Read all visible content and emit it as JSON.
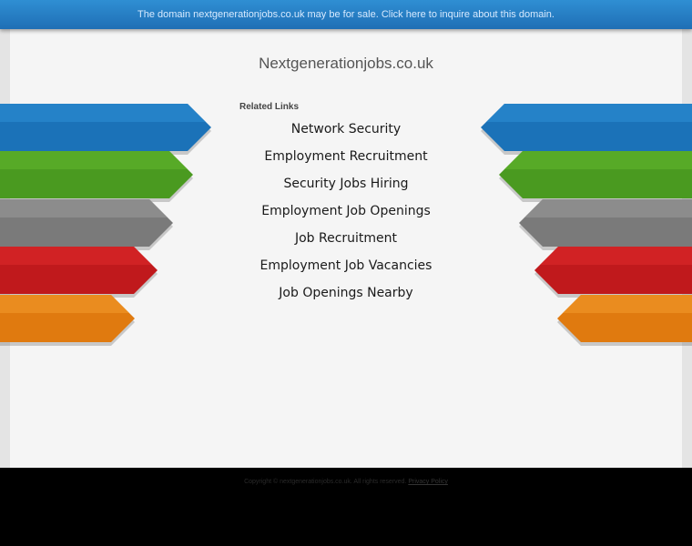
{
  "banner": {
    "text": "The domain nextgenerationjobs.co.uk may be for sale. Click here to inquire about this domain."
  },
  "domain_title": "Nextgenerationjobs.co.uk",
  "related": {
    "heading": "Related Links",
    "links": [
      "Network Security",
      "Employment Recruitment",
      "Security Jobs Hiring",
      "Employment Job Openings",
      "Job Recruitment",
      "Employment Job Vacancies",
      "Job Openings Nearby"
    ]
  },
  "arrows": {
    "colors": [
      "#1b72b8",
      "#4a9a20",
      "#7a7a7a",
      "#c0191c",
      "#e07a0f"
    ],
    "highlights": [
      "#2d8fd6",
      "#63b82e",
      "#9a9a9a",
      "#de2a2c",
      "#f29a2e"
    ]
  },
  "footer": {
    "copyright": "Copyright © nextgenerationjobs.co.uk. All rights reserved.",
    "privacy_label": "Privacy Policy"
  }
}
